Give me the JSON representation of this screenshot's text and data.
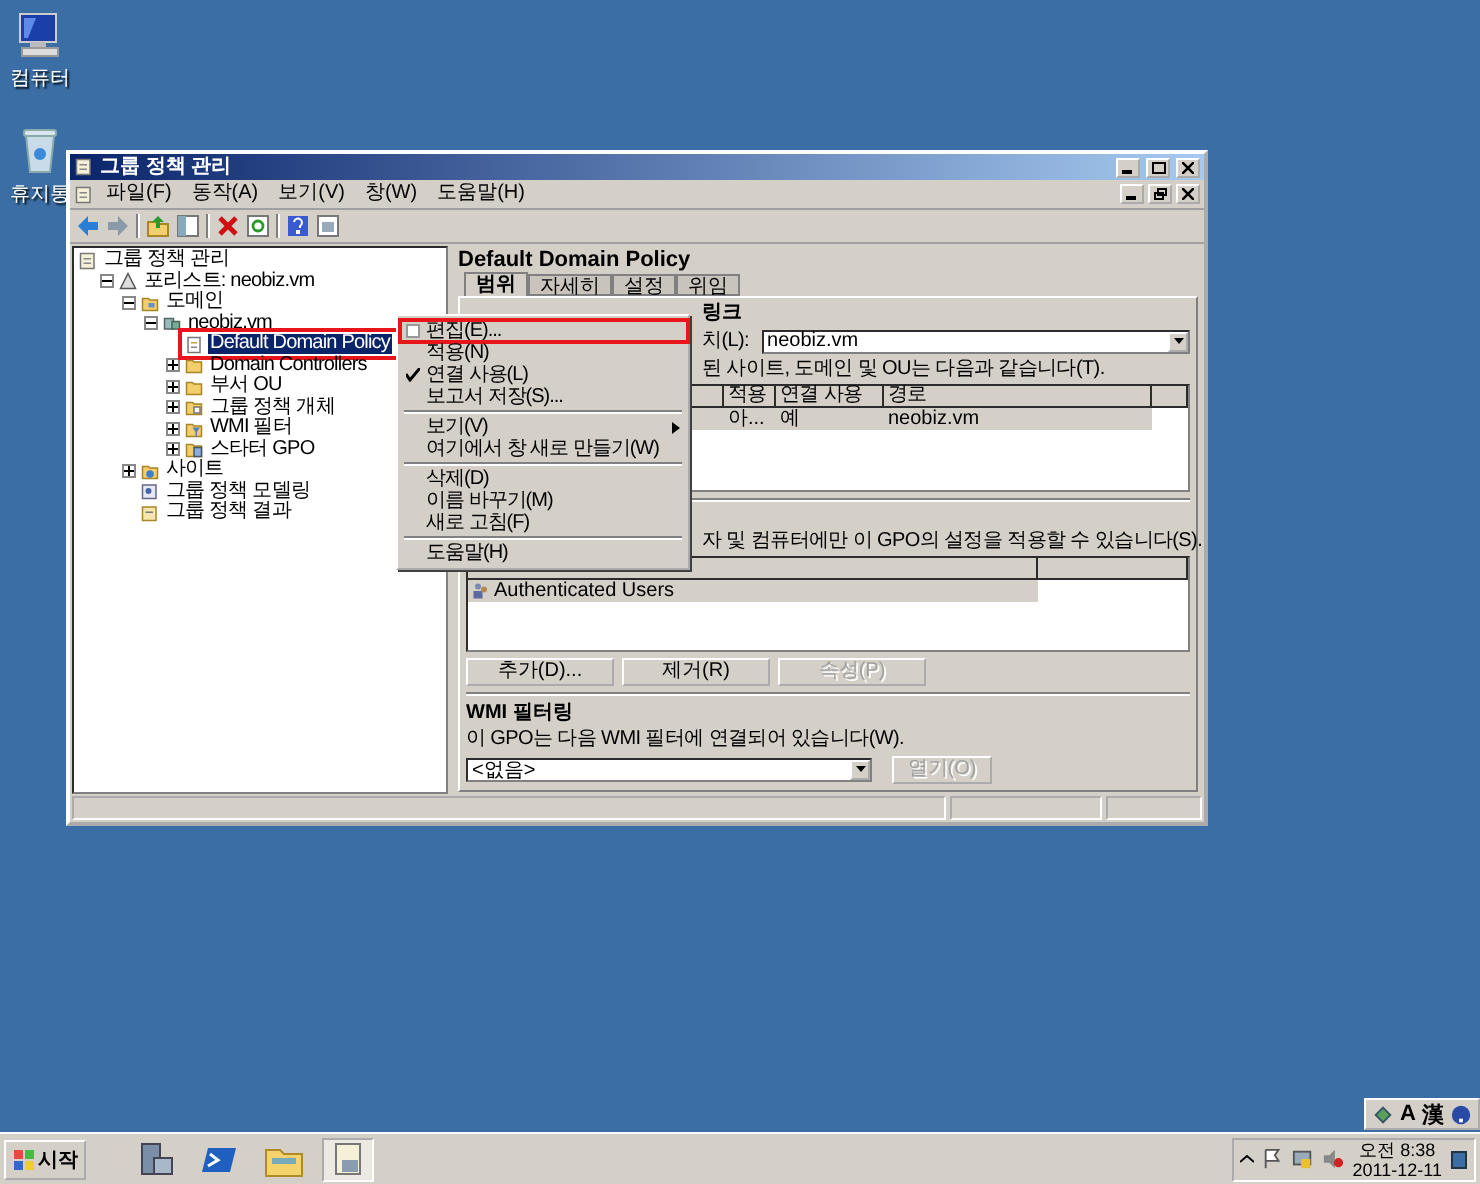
{
  "desktop_icons": [
    {
      "label": "컴퓨터",
      "kind": "computer"
    },
    {
      "label": "휴지통",
      "kind": "recycle"
    }
  ],
  "window": {
    "title": "그룹 정책 관리"
  },
  "menu_bar": [
    "파일(F)",
    "동작(A)",
    "보기(V)",
    "창(W)",
    "도움말(H)"
  ],
  "tree": [
    {
      "label": "그룹 정책 관리",
      "kind": "console",
      "selected": false,
      "children": [
        {
          "label": "포리스트: neobiz.vm",
          "kind": "forest",
          "expanded": true,
          "selected": false,
          "children": [
            {
              "label": "도메인",
              "kind": "domains",
              "expanded": true,
              "selected": false,
              "children": [
                {
                  "label": "neobiz.vm",
                  "kind": "domain",
                  "expanded": true,
                  "selected": false,
                  "children": [
                    {
                      "label": "Default Domain Policy",
                      "kind": "gpo",
                      "selected": true
                    },
                    {
                      "label": "Domain Controllers",
                      "kind": "ou",
                      "expanded": false,
                      "selected": false
                    },
                    {
                      "label": "부서 OU",
                      "kind": "ou",
                      "expanded": false,
                      "selected": false
                    },
                    {
                      "label": "그룹 정책 개체",
                      "kind": "folder",
                      "expanded": false,
                      "selected": false
                    },
                    {
                      "label": "WMI 필터",
                      "kind": "filter",
                      "expanded": false,
                      "selected": false
                    },
                    {
                      "label": "스타터 GPO",
                      "kind": "starter",
                      "expanded": false,
                      "selected": false
                    }
                  ]
                }
              ]
            },
            {
              "label": "사이트",
              "kind": "sites",
              "expanded": false,
              "selected": false
            },
            {
              "label": "그룹 정책 모델링",
              "kind": "modeling",
              "selected": false
            },
            {
              "label": "그룹 정책 결과",
              "kind": "results",
              "selected": false
            }
          ]
        }
      ]
    }
  ],
  "details": {
    "title": "Default Domain Policy",
    "tabs": [
      {
        "label": "범위",
        "selected": true
      },
      {
        "label": "자세히",
        "selected": false
      },
      {
        "label": "설정",
        "selected": false
      },
      {
        "label": "위임",
        "selected": false
      }
    ],
    "links": {
      "heading": "링크",
      "location_label": "치(L):",
      "location_value": "neobiz.vm",
      "description": "된 사이트, 도메인 및 OU는 다음과 같습니다(T).",
      "columns": [
        "적용",
        "연결 사용",
        "경로"
      ],
      "rows": [
        {
          "cells": [
            "아...",
            "예",
            "neobiz.vm"
          ],
          "selected": true
        }
      ]
    },
    "security": {
      "description": "자 및 컴퓨터에만 이 GPO의 설정을 적용할 수 있습니다(S).",
      "rows": [
        {
          "label": "Authenticated Users",
          "selected": true
        }
      ],
      "buttons": [
        {
          "label": "추가(D)...",
          "disabled": false
        },
        {
          "label": "제거(R)",
          "disabled": false
        },
        {
          "label": "속성(P)",
          "disabled": true
        }
      ]
    },
    "wmi": {
      "heading": "WMI 필터링",
      "description": "이 GPO는 다음 WMI 필터에 연결되어 있습니다(W).",
      "value": "<없음>",
      "button": {
        "label": "열기(O)",
        "disabled": true
      }
    }
  },
  "context_menu": [
    {
      "kind": "item",
      "label": "편집(E)...",
      "icon": true,
      "checked": false,
      "submenu": false
    },
    {
      "kind": "item",
      "label": "적용(N)",
      "icon": false,
      "checked": false,
      "submenu": false
    },
    {
      "kind": "item",
      "label": "연결 사용(L)",
      "icon": false,
      "checked": true,
      "submenu": false
    },
    {
      "kind": "item",
      "label": "보고서 저장(S)...",
      "icon": false,
      "checked": false,
      "submenu": false
    },
    {
      "kind": "separator"
    },
    {
      "kind": "item",
      "label": "보기(V)",
      "icon": false,
      "checked": false,
      "submenu": true
    },
    {
      "kind": "item",
      "label": "여기에서 창 새로 만들기(W)",
      "icon": false,
      "checked": false,
      "submenu": false
    },
    {
      "kind": "separator"
    },
    {
      "kind": "item",
      "label": "삭제(D)",
      "icon": false,
      "checked": false,
      "submenu": false
    },
    {
      "kind": "item",
      "label": "이름 바꾸기(M)",
      "icon": false,
      "checked": false,
      "submenu": false
    },
    {
      "kind": "item",
      "label": "새로 고침(F)",
      "icon": false,
      "checked": false,
      "submenu": false
    },
    {
      "kind": "separator"
    },
    {
      "kind": "item",
      "label": "도움말(H)",
      "icon": false,
      "checked": false,
      "submenu": false
    }
  ],
  "language_bar": [
    "A",
    "漢"
  ],
  "taskbar": {
    "start": "시작",
    "tasks": [
      {
        "kind": "server",
        "selected": false
      },
      {
        "kind": "powershell",
        "selected": false
      },
      {
        "kind": "folder",
        "selected": false
      },
      {
        "kind": "console",
        "selected": true
      }
    ],
    "clock": {
      "time": "오전 8:38",
      "date": "2011-12-11"
    }
  }
}
